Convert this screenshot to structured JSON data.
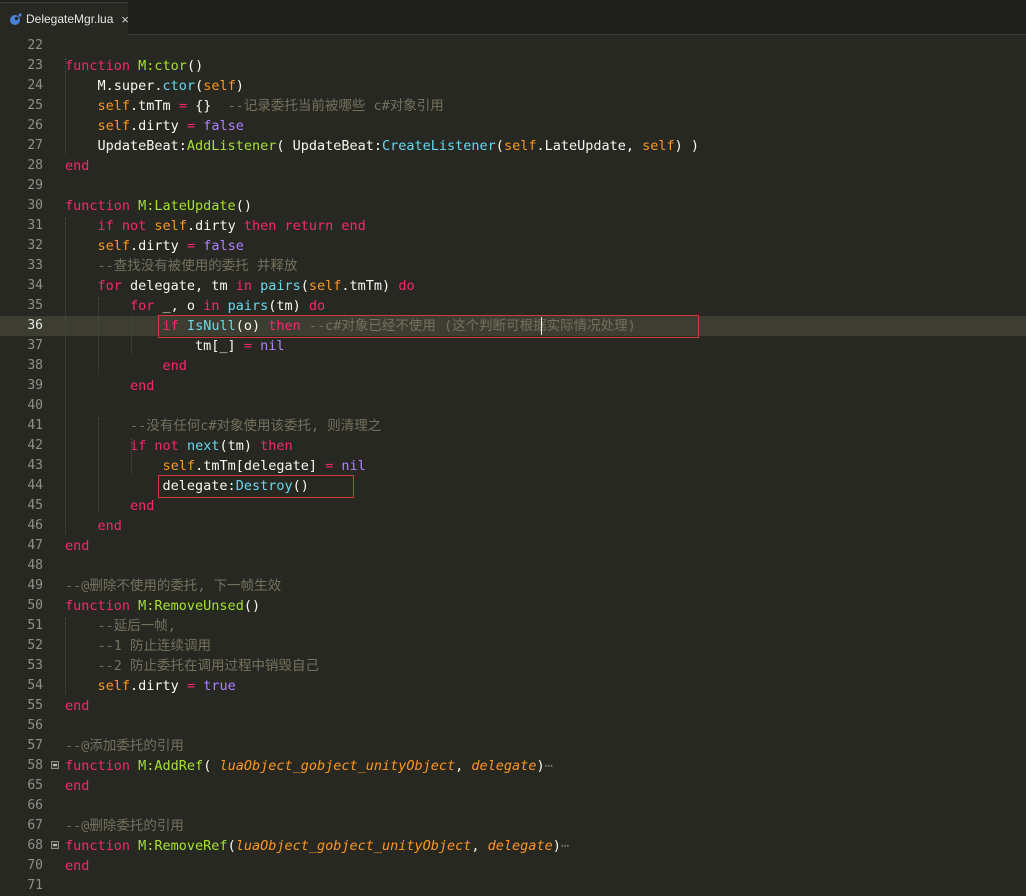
{
  "tab": {
    "title": "DelegateMgr.lua",
    "close": "×",
    "icon": "lua-file-icon"
  },
  "colors": {
    "background": "#272822",
    "keyword": "#f92672",
    "builtin": "#66d9ef",
    "function": "#a6e22e",
    "comment": "#75715e",
    "number": "#ae81ff",
    "param": "#fd971f",
    "highlight_box": "#d23a3a"
  },
  "current_line": "36",
  "lines": [
    {
      "n": "22",
      "tokens": []
    },
    {
      "n": "23",
      "tokens": [
        [
          "k",
          "function "
        ],
        [
          "f",
          "M:ctor"
        ],
        [
          "e",
          "()"
        ]
      ]
    },
    {
      "n": "24",
      "tokens": [
        [
          "e",
          "    M.super."
        ],
        [
          "s",
          "ctor"
        ],
        [
          "e",
          "("
        ],
        [
          "p2",
          "self"
        ],
        [
          "e",
          ")"
        ]
      ]
    },
    {
      "n": "25",
      "tokens": [
        [
          "e",
          "    "
        ],
        [
          "p2",
          "self"
        ],
        [
          "e",
          ".tmTm "
        ],
        [
          "o",
          "="
        ],
        [
          "e",
          " {}  "
        ],
        [
          "c",
          "--记录委托当前被哪些 c#对象引用"
        ]
      ]
    },
    {
      "n": "26",
      "tokens": [
        [
          "e",
          "    "
        ],
        [
          "p2",
          "self"
        ],
        [
          "e",
          ".dirty "
        ],
        [
          "o",
          "="
        ],
        [
          "e",
          " "
        ],
        [
          "n",
          "false"
        ]
      ]
    },
    {
      "n": "27",
      "tokens": [
        [
          "e",
          "    UpdateBeat:"
        ],
        [
          "f",
          "AddListener"
        ],
        [
          "e",
          "( UpdateBeat:"
        ],
        [
          "s",
          "CreateListener"
        ],
        [
          "e",
          "("
        ],
        [
          "p2",
          "self"
        ],
        [
          "e",
          ".LateUpdate, "
        ],
        [
          "p2",
          "self"
        ],
        [
          "e",
          ") )"
        ]
      ]
    },
    {
      "n": "28",
      "tokens": [
        [
          "k",
          "end"
        ]
      ]
    },
    {
      "n": "29",
      "tokens": []
    },
    {
      "n": "30",
      "tokens": [
        [
          "k",
          "function "
        ],
        [
          "f",
          "M:LateUpdate"
        ],
        [
          "e",
          "()"
        ]
      ]
    },
    {
      "n": "31",
      "tokens": [
        [
          "e",
          "    "
        ],
        [
          "k",
          "if not "
        ],
        [
          "p2",
          "self"
        ],
        [
          "e",
          ".dirty "
        ],
        [
          "k",
          "then return end"
        ]
      ]
    },
    {
      "n": "32",
      "tokens": [
        [
          "e",
          "    "
        ],
        [
          "p2",
          "self"
        ],
        [
          "e",
          ".dirty "
        ],
        [
          "o",
          "="
        ],
        [
          "e",
          " "
        ],
        [
          "n",
          "false"
        ]
      ]
    },
    {
      "n": "33",
      "tokens": [
        [
          "e",
          "    "
        ],
        [
          "c",
          "--查找没有被使用的委托 并释放"
        ]
      ]
    },
    {
      "n": "34",
      "tokens": [
        [
          "e",
          "    "
        ],
        [
          "k",
          "for"
        ],
        [
          "e",
          " delegate, tm "
        ],
        [
          "k",
          "in"
        ],
        [
          "e",
          " "
        ],
        [
          "s",
          "pairs"
        ],
        [
          "e",
          "("
        ],
        [
          "p2",
          "self"
        ],
        [
          "e",
          ".tmTm) "
        ],
        [
          "k",
          "do"
        ]
      ]
    },
    {
      "n": "35",
      "tokens": [
        [
          "e",
          "        "
        ],
        [
          "k",
          "for"
        ],
        [
          "e",
          " _, o "
        ],
        [
          "k",
          "in"
        ],
        [
          "e",
          " "
        ],
        [
          "s",
          "pairs"
        ],
        [
          "e",
          "(tm) "
        ],
        [
          "k",
          "do"
        ]
      ]
    },
    {
      "n": "36",
      "tokens": [
        [
          "e",
          "            "
        ],
        [
          "k",
          "if"
        ],
        [
          "e",
          " "
        ],
        [
          "s",
          "IsNull"
        ],
        [
          "e",
          "(o) "
        ],
        [
          "k",
          "then"
        ],
        [
          "e",
          " "
        ],
        [
          "c",
          "--c#对象已经不使用 (这个判断可根据实际情况处理)"
        ]
      ]
    },
    {
      "n": "37",
      "tokens": [
        [
          "e",
          "                tm[_] "
        ],
        [
          "o",
          "="
        ],
        [
          "e",
          " "
        ],
        [
          "n",
          "nil"
        ]
      ]
    },
    {
      "n": "38",
      "tokens": [
        [
          "e",
          "            "
        ],
        [
          "k",
          "end"
        ]
      ]
    },
    {
      "n": "39",
      "tokens": [
        [
          "e",
          "        "
        ],
        [
          "k",
          "end"
        ]
      ]
    },
    {
      "n": "40",
      "tokens": []
    },
    {
      "n": "41",
      "tokens": [
        [
          "e",
          "        "
        ],
        [
          "c",
          "--没有任何c#对象使用该委托, 则清理之"
        ]
      ]
    },
    {
      "n": "42",
      "tokens": [
        [
          "e",
          "        "
        ],
        [
          "k",
          "if not "
        ],
        [
          "s",
          "next"
        ],
        [
          "e",
          "(tm) "
        ],
        [
          "k",
          "then"
        ]
      ]
    },
    {
      "n": "43",
      "tokens": [
        [
          "e",
          "            "
        ],
        [
          "p2",
          "self"
        ],
        [
          "e",
          ".tmTm[delegate] "
        ],
        [
          "o",
          "="
        ],
        [
          "e",
          " "
        ],
        [
          "n",
          "nil"
        ]
      ]
    },
    {
      "n": "44",
      "tokens": [
        [
          "e",
          "            delegate:"
        ],
        [
          "s",
          "Destroy"
        ],
        [
          "e",
          "()"
        ]
      ]
    },
    {
      "n": "45",
      "tokens": [
        [
          "e",
          "        "
        ],
        [
          "k",
          "end"
        ]
      ]
    },
    {
      "n": "46",
      "tokens": [
        [
          "e",
          "    "
        ],
        [
          "k",
          "end"
        ]
      ]
    },
    {
      "n": "47",
      "tokens": [
        [
          "k",
          "end"
        ]
      ]
    },
    {
      "n": "48",
      "tokens": []
    },
    {
      "n": "49",
      "tokens": [
        [
          "c",
          "--@删除不使用的委托, 下一帧生效"
        ]
      ]
    },
    {
      "n": "50",
      "tokens": [
        [
          "k",
          "function "
        ],
        [
          "f",
          "M:RemoveUnsed"
        ],
        [
          "e",
          "()"
        ]
      ]
    },
    {
      "n": "51",
      "tokens": [
        [
          "e",
          "    "
        ],
        [
          "c",
          "--延后一帧,"
        ]
      ]
    },
    {
      "n": "52",
      "tokens": [
        [
          "e",
          "    "
        ],
        [
          "c",
          "--1 防止连续调用"
        ]
      ]
    },
    {
      "n": "53",
      "tokens": [
        [
          "e",
          "    "
        ],
        [
          "c",
          "--2 防止委托在调用过程中销毁自己"
        ]
      ]
    },
    {
      "n": "54",
      "tokens": [
        [
          "e",
          "    "
        ],
        [
          "p2",
          "self"
        ],
        [
          "e",
          ".dirty "
        ],
        [
          "o",
          "="
        ],
        [
          "e",
          " "
        ],
        [
          "n",
          "true"
        ]
      ]
    },
    {
      "n": "55",
      "tokens": [
        [
          "k",
          "end"
        ]
      ]
    },
    {
      "n": "56",
      "tokens": []
    },
    {
      "n": "57",
      "tokens": [
        [
          "c",
          "--@添加委托的引用"
        ]
      ]
    },
    {
      "n": "58",
      "fold": true,
      "tokens": [
        [
          "k",
          "function "
        ],
        [
          "f",
          "M:AddRef"
        ],
        [
          "e",
          "( "
        ],
        [
          "p",
          "luaObject_gobject_unityObject"
        ],
        [
          "e",
          ", "
        ],
        [
          "p",
          "delegate"
        ],
        [
          "e",
          ")"
        ],
        [
          "c",
          "⋯"
        ]
      ]
    },
    {
      "n": "65",
      "tokens": [
        [
          "k",
          "end"
        ]
      ]
    },
    {
      "n": "66",
      "tokens": []
    },
    {
      "n": "67",
      "tokens": [
        [
          "c",
          "--@删除委托的引用"
        ]
      ]
    },
    {
      "n": "68",
      "fold": true,
      "tokens": [
        [
          "k",
          "function "
        ],
        [
          "f",
          "M:RemoveRef"
        ],
        [
          "e",
          "("
        ],
        [
          "p",
          "luaObject_gobject_unityObject"
        ],
        [
          "e",
          ", "
        ],
        [
          "p",
          "delegate"
        ],
        [
          "e",
          ")"
        ],
        [
          "c",
          "⋯"
        ]
      ]
    },
    {
      "n": "70",
      "tokens": [
        [
          "k",
          "end"
        ]
      ]
    },
    {
      "n": "71",
      "tokens": []
    }
  ]
}
